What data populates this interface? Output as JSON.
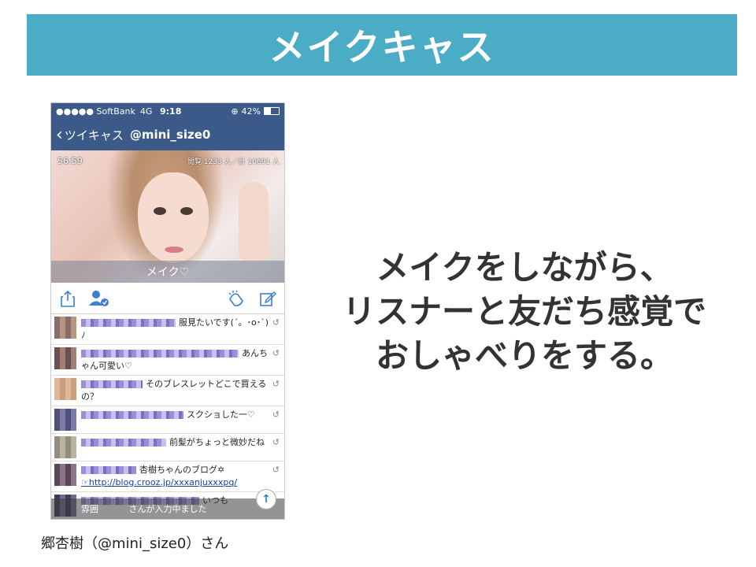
{
  "slide": {
    "title": "メイクキャス",
    "message_lines": [
      "メイクをしながら、",
      "リスナーと友だち感覚で",
      "おしゃべりをする。"
    ],
    "credit": "郷杏樹（@mini_size0）さん",
    "colors": {
      "banner": "#4bacc6",
      "nav": "#3b5a8a"
    }
  },
  "phone": {
    "status": {
      "carrier": "●●●●● SoftBank",
      "network": "4G",
      "time": "9:18",
      "battery": "42%",
      "battery_level": 0.42
    },
    "nav": {
      "back_label": "ツイキャス",
      "handle": "@mini_size0"
    },
    "video": {
      "timer": "56:59",
      "views": "閲覧 1233 人／計 10691 人",
      "caption": "メイク♡"
    },
    "toolbar": {
      "share_icon": "share-icon",
      "user_icon": "user-check-icon",
      "clap_icon": "clap-icon",
      "compose_icon": "compose-icon"
    },
    "comments": [
      {
        "text": "服見たいです(´。･o･`)ﾉ"
      },
      {
        "text": "あんちゃん可愛い♡"
      },
      {
        "text": "そのブレスレットどこで買えるの？"
      },
      {
        "text": "スクショした一♡"
      },
      {
        "text": "前髪がちょっと微妙だね"
      },
      {
        "text": "杏樹ちゃんのブログ✡",
        "link": "☞http://blog.crooz.jp/xxxanjuxxxpq/"
      },
      {
        "text": "いつも"
      }
    ],
    "input_text": "さんが入力中",
    "partial_text": "雰囲",
    "partial_text2": "ました"
  }
}
